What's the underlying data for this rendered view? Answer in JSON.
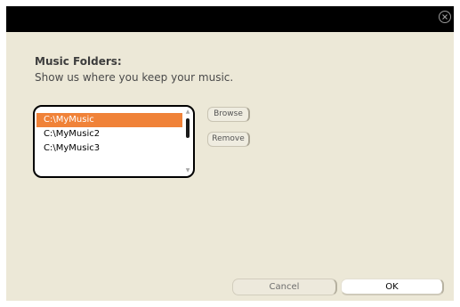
{
  "dialog": {
    "close_icon": "close-circle-icon"
  },
  "music_folders": {
    "heading": "Music Folders:",
    "description": "Show us where you keep your music.",
    "folders": [
      {
        "path": "C:\\MyMusic",
        "selected": true
      },
      {
        "path": "C:\\MyMusic2",
        "selected": false
      },
      {
        "path": "C:\\MyMusic3",
        "selected": false
      }
    ],
    "browse_label": "Browse",
    "remove_label": "Remove"
  },
  "footer": {
    "cancel_label": "Cancel",
    "ok_label": "OK"
  },
  "colors": {
    "selection": "#f08238",
    "background": "#ece8d7",
    "titlebar": "#000000"
  }
}
